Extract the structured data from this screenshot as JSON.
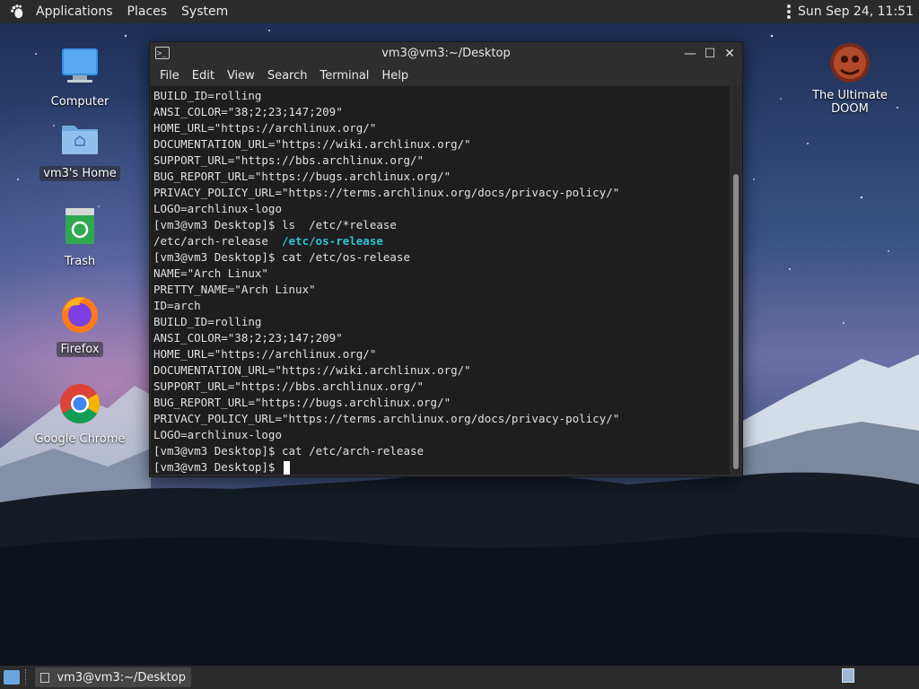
{
  "top_panel": {
    "menus": [
      "Applications",
      "Places",
      "System"
    ],
    "clock": "Sun Sep 24, 11:51"
  },
  "desktop_icons": [
    {
      "label": "Computer",
      "icon": "computer-icon"
    },
    {
      "label": "vm3's Home",
      "icon": "home-folder-icon"
    },
    {
      "label": "Trash",
      "icon": "trash-icon"
    },
    {
      "label": "Firefox",
      "icon": "firefox-icon"
    },
    {
      "label": "Google Chrome",
      "icon": "chrome-icon"
    },
    {
      "label": "The Ultimate DOOM",
      "icon": "doom-icon"
    }
  ],
  "terminal": {
    "title": "vm3@vm3:~/Desktop",
    "menus": [
      "File",
      "Edit",
      "View",
      "Search",
      "Terminal",
      "Help"
    ],
    "lines": [
      "BUILD_ID=rolling",
      "ANSI_COLOR=\"38;2;23;147;209\"",
      "HOME_URL=\"https://archlinux.org/\"",
      "DOCUMENTATION_URL=\"https://wiki.archlinux.org/\"",
      "SUPPORT_URL=\"https://bbs.archlinux.org/\"",
      "BUG_REPORT_URL=\"https://bugs.archlinux.org/\"",
      "PRIVACY_POLICY_URL=\"https://terms.archlinux.org/docs/privacy-policy/\"",
      "LOGO=archlinux-logo",
      "[vm3@vm3 Desktop]$ ls  /etc/*release",
      "/etc/arch-release  ",
      "[vm3@vm3 Desktop]$ cat /etc/os-release",
      "NAME=\"Arch Linux\"",
      "PRETTY_NAME=\"Arch Linux\"",
      "ID=arch",
      "BUILD_ID=rolling",
      "ANSI_COLOR=\"38;2;23;147;209\"",
      "HOME_URL=\"https://archlinux.org/\"",
      "DOCUMENTATION_URL=\"https://wiki.archlinux.org/\"",
      "SUPPORT_URL=\"https://bbs.archlinux.org/\"",
      "BUG_REPORT_URL=\"https://bugs.archlinux.org/\"",
      "PRIVACY_POLICY_URL=\"https://terms.archlinux.org/docs/privacy-policy/\"",
      "LOGO=archlinux-logo",
      "[vm3@vm3 Desktop]$ cat /etc/arch-release",
      "[vm3@vm3 Desktop]$ "
    ],
    "highlighted_file": "/etc/os-release",
    "highlight_color": "#2ec3d3"
  },
  "taskbar": {
    "task_label": "vm3@vm3:~/Desktop"
  }
}
